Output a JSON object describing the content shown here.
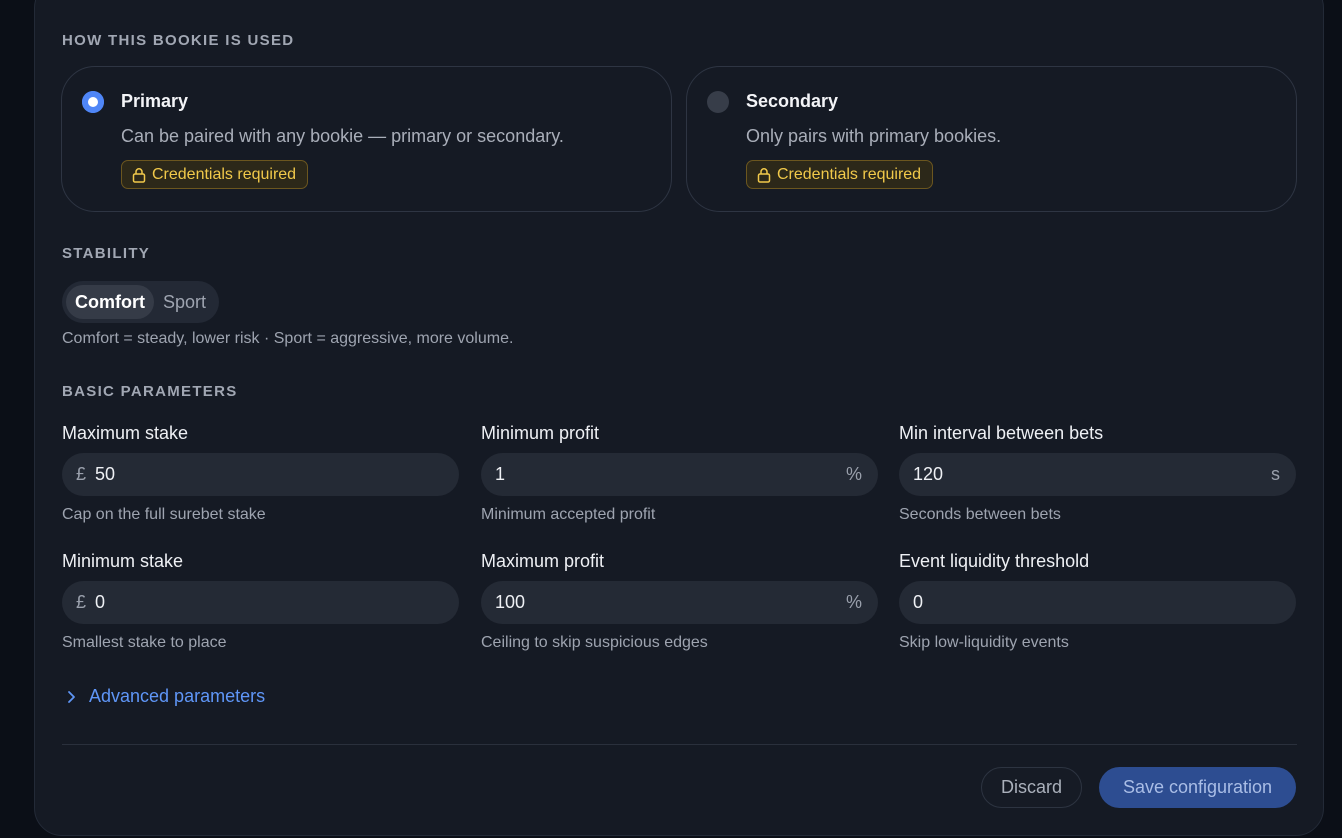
{
  "usage": {
    "section_label": "HOW THIS BOOKIE IS USED",
    "options": [
      {
        "title": "Primary",
        "description": "Can be paired with any bookie — primary or secondary.",
        "badge": "Credentials required",
        "selected": true
      },
      {
        "title": "Secondary",
        "description": "Only pairs with primary bookies.",
        "badge": "Credentials required",
        "selected": false
      }
    ]
  },
  "stability": {
    "section_label": "STABILITY",
    "options": [
      "Comfort",
      "Sport"
    ],
    "selected": "Comfort",
    "hint": "Comfort = steady, lower risk · Sport = aggressive, more volume."
  },
  "basic": {
    "section_label": "BASIC PARAMETERS",
    "fields": [
      {
        "label": "Maximum stake",
        "prefix": "£",
        "value": "50",
        "suffix": "",
        "hint": "Cap on the full surebet stake"
      },
      {
        "label": "Minimum profit",
        "prefix": "",
        "value": "1",
        "suffix": "%",
        "hint": "Minimum accepted profit"
      },
      {
        "label": "Min interval between bets",
        "prefix": "",
        "value": "120",
        "suffix": "s",
        "hint": "Seconds between bets"
      },
      {
        "label": "Minimum stake",
        "prefix": "£",
        "value": "0",
        "suffix": "",
        "hint": "Smallest stake to place"
      },
      {
        "label": "Maximum profit",
        "prefix": "",
        "value": "100",
        "suffix": "%",
        "hint": "Ceiling to skip suspicious edges"
      },
      {
        "label": "Event liquidity threshold",
        "prefix": "",
        "value": "0",
        "suffix": "",
        "hint": "Skip low-liquidity events"
      }
    ]
  },
  "advanced": {
    "label": "Advanced parameters",
    "icon": "chevron-right-icon"
  },
  "footer": {
    "discard_label": "Discard",
    "save_label": "Save configuration"
  },
  "colors": {
    "accent": "#4f86f7",
    "badge_text": "#f1c94a",
    "save_button": "#2d4d91"
  }
}
